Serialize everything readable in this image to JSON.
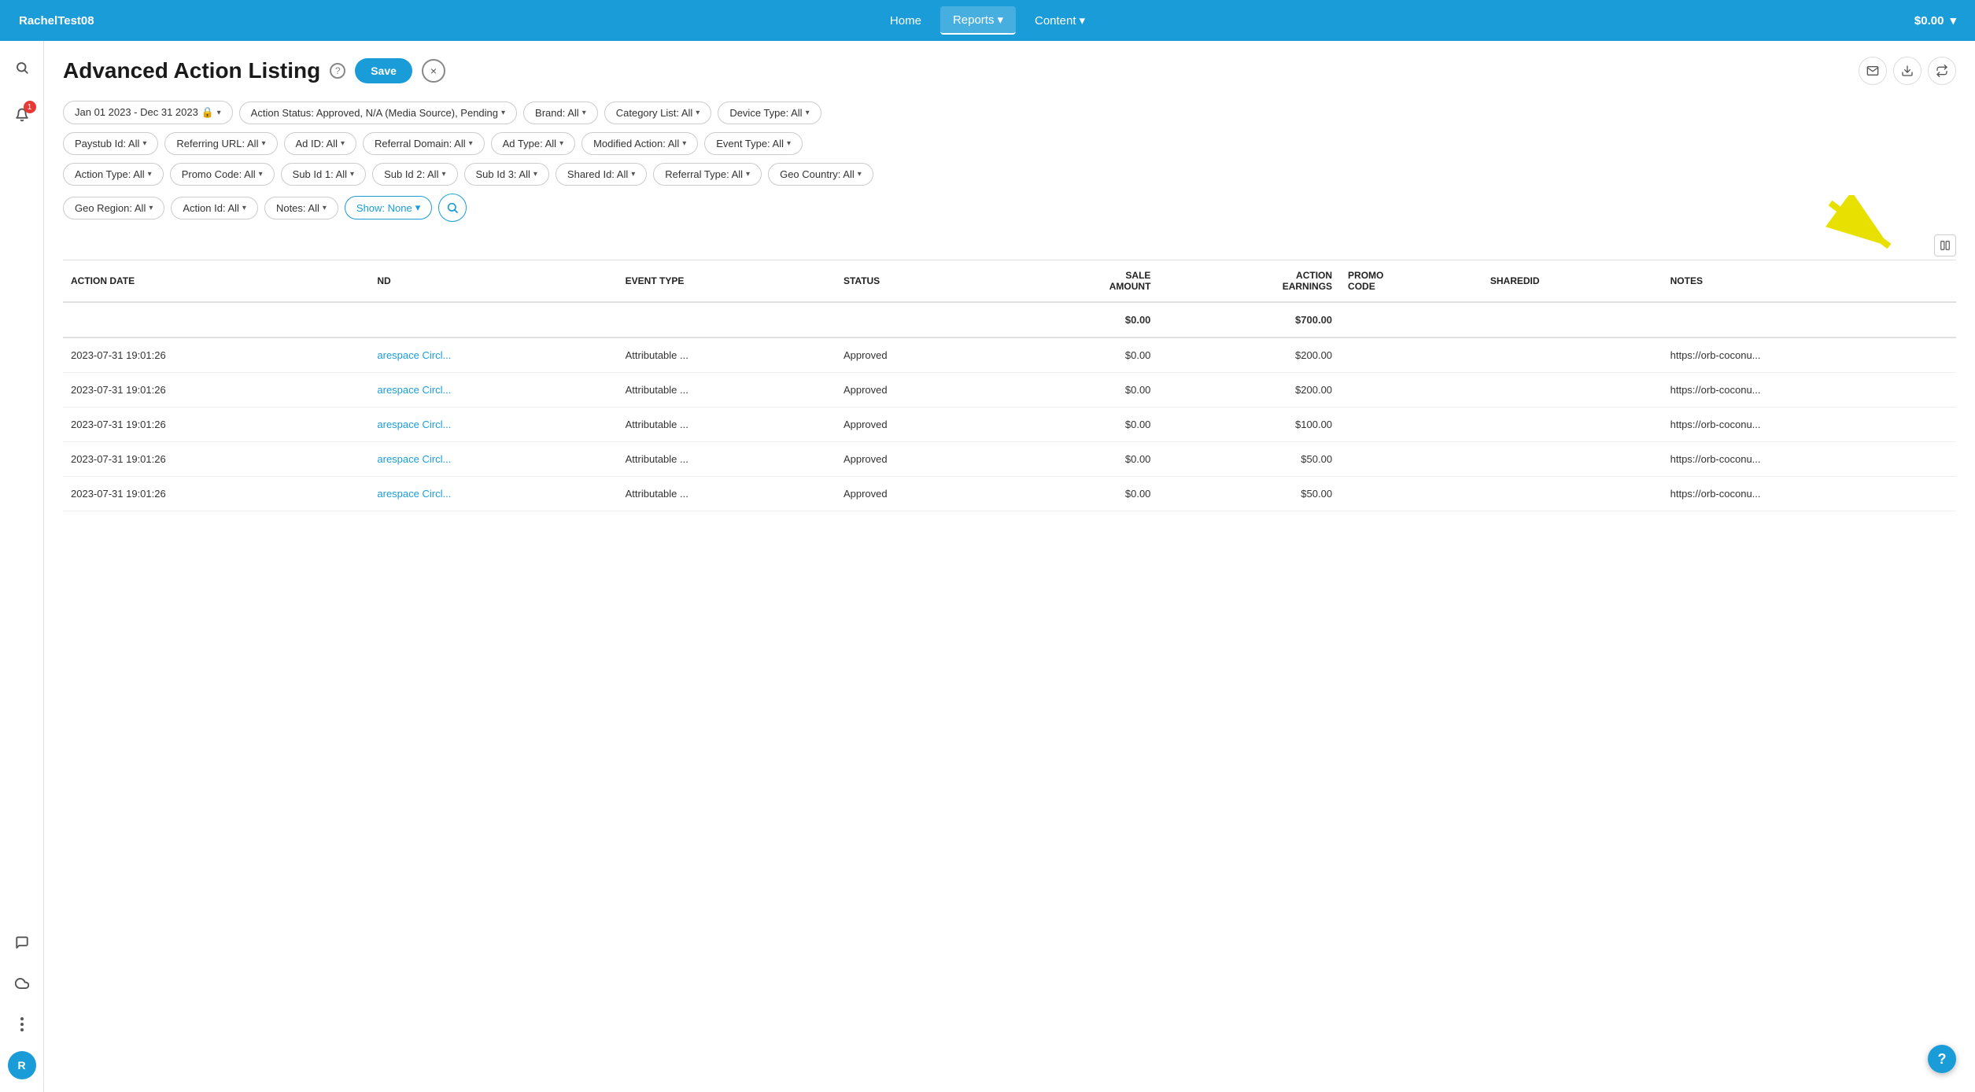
{
  "nav": {
    "brand": "RachelTest08",
    "items": [
      {
        "label": "Home",
        "active": false
      },
      {
        "label": "Reports",
        "active": true
      },
      {
        "label": "Content",
        "active": false
      }
    ],
    "balance": "$0.00"
  },
  "page": {
    "title": "Advanced Action Listing",
    "save_label": "Save",
    "close_label": "×"
  },
  "filters": {
    "row1": [
      {
        "label": "Jan 01 2023 - Dec 31 2023 🔒"
      },
      {
        "label": "Action Status: Approved, N/A (Media Source), Pending"
      },
      {
        "label": "Brand: All"
      },
      {
        "label": "Category List: All"
      },
      {
        "label": "Device Type: All"
      }
    ],
    "row2": [
      {
        "label": "Paystub Id: All"
      },
      {
        "label": "Referring URL: All"
      },
      {
        "label": "Ad ID: All"
      },
      {
        "label": "Referral Domain: All"
      },
      {
        "label": "Ad Type: All"
      },
      {
        "label": "Modified Action: All"
      },
      {
        "label": "Event Type: All"
      }
    ],
    "row3": [
      {
        "label": "Action Type: All"
      },
      {
        "label": "Promo Code: All"
      },
      {
        "label": "Sub Id 1: All"
      },
      {
        "label": "Sub Id 2: All"
      },
      {
        "label": "Sub Id 3: All"
      },
      {
        "label": "Shared Id: All"
      },
      {
        "label": "Referral Type: All"
      },
      {
        "label": "Geo Country: All"
      }
    ],
    "row4": [
      {
        "label": "Geo Region: All"
      },
      {
        "label": "Action Id: All"
      },
      {
        "label": "Notes: All"
      }
    ],
    "show_label": "Show: None"
  },
  "table": {
    "columns": [
      {
        "key": "action_date",
        "label": "ACTION DATE"
      },
      {
        "key": "brand",
        "label": "ND"
      },
      {
        "key": "event_type",
        "label": "EVENT TYPE"
      },
      {
        "key": "status",
        "label": "STATUS"
      },
      {
        "key": "sale_amount",
        "label": "SALE\nAMOUNT",
        "right": true
      },
      {
        "key": "action_earnings",
        "label": "ACTION\nEARNINGS",
        "right": true
      },
      {
        "key": "promo_code",
        "label": "PROMO\nCODE"
      },
      {
        "key": "sharedid",
        "label": "SHAREDID"
      },
      {
        "key": "notes",
        "label": "NOTES"
      }
    ],
    "totals": {
      "sale_amount": "$0.00",
      "action_earnings": "$700.00"
    },
    "rows": [
      {
        "action_date": "2023-07-31 19:01:26",
        "brand": "arespace Circl...",
        "event_type": "Attributable ...",
        "status": "Approved",
        "sale_amount": "$0.00",
        "action_earnings": "$200.00",
        "promo_code": "",
        "sharedid": "",
        "notes": "https://orb-coconu..."
      },
      {
        "action_date": "2023-07-31 19:01:26",
        "brand": "arespace Circl...",
        "event_type": "Attributable ...",
        "status": "Approved",
        "sale_amount": "$0.00",
        "action_earnings": "$200.00",
        "promo_code": "",
        "sharedid": "",
        "notes": "https://orb-coconu..."
      },
      {
        "action_date": "2023-07-31 19:01:26",
        "brand": "arespace Circl...",
        "event_type": "Attributable ...",
        "status": "Approved",
        "sale_amount": "$0.00",
        "action_earnings": "$100.00",
        "promo_code": "",
        "sharedid": "",
        "notes": "https://orb-coconu..."
      },
      {
        "action_date": "2023-07-31 19:01:26",
        "brand": "arespace Circl...",
        "event_type": "Attributable ...",
        "status": "Approved",
        "sale_amount": "$0.00",
        "action_earnings": "$50.00",
        "promo_code": "",
        "sharedid": "",
        "notes": "https://orb-coconu..."
      },
      {
        "action_date": "2023-07-31 19:01:26",
        "brand": "arespace Circl...",
        "event_type": "Attributable ...",
        "status": "Approved",
        "sale_amount": "$0.00",
        "action_earnings": "$50.00",
        "promo_code": "",
        "sharedid": "",
        "notes": "https://orb-coconu..."
      }
    ]
  },
  "sidebar": {
    "search_icon": "🔍",
    "bell_icon": "🔔",
    "notification_count": "1",
    "chat_icon": "💬",
    "cloud_icon": "☁",
    "dots": "⋮",
    "avatar_label": "R"
  },
  "help_label": "?"
}
